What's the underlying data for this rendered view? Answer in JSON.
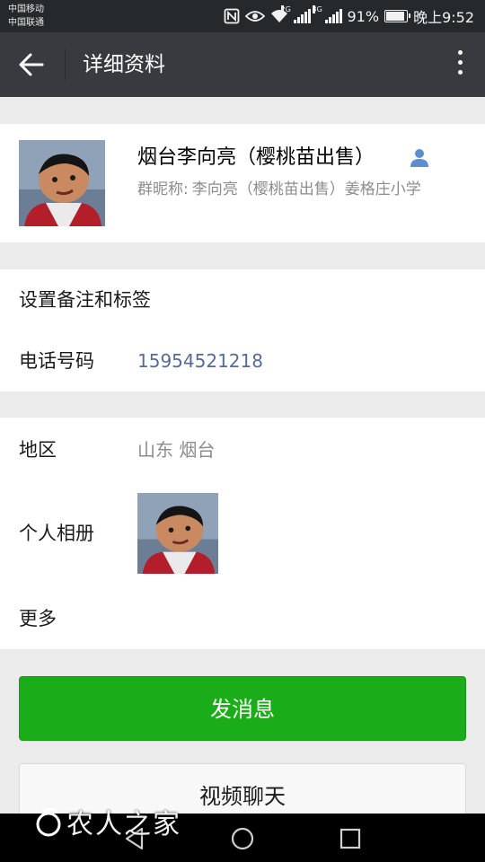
{
  "status": {
    "carrier1": "中国移动",
    "carrier2": "中国联通",
    "net1": "2G",
    "net2": "3G",
    "battery": "91%",
    "battery_level": 0.91,
    "time": "晚上9:52"
  },
  "header": {
    "title": "详细资料",
    "back_icon": "back-arrow-icon",
    "more_icon": "more-vertical-icon"
  },
  "profile": {
    "name": "烟台李向亮（樱桃苗出售）",
    "nickname_label": "群昵称:",
    "nickname": "李向亮（樱桃苗出售）姜格庄小学",
    "badge_icon": "contact-person-icon"
  },
  "rows": {
    "remark_label": "设置备注和标签",
    "phone_label": "电话号码",
    "phone_value": "15954521218",
    "region_label": "地区",
    "region_value": "山东  烟台",
    "album_label": "个人相册",
    "more_label": "更多"
  },
  "buttons": {
    "message": "发消息",
    "video_call": "视频聊天"
  },
  "watermark": "农人之家",
  "colors": {
    "accent_green": "#1aad19",
    "titlebar": "#393a3f",
    "link_blue": "#576b95"
  }
}
